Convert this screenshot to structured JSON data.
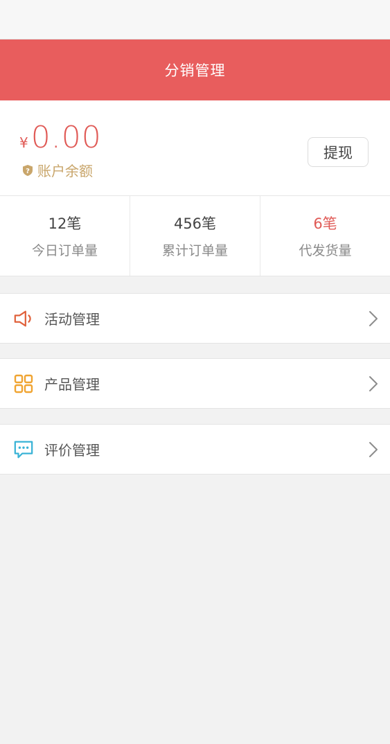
{
  "header": {
    "title": "分销管理"
  },
  "balance": {
    "currency_symbol": "¥",
    "amount": "0.00",
    "label": "账户余额",
    "withdraw_label": "提现"
  },
  "stats": [
    {
      "value": "12笔",
      "label": "今日订单量",
      "color": "#444444"
    },
    {
      "value": "456笔",
      "label": "累计订单量",
      "color": "#444444"
    },
    {
      "value": "6笔",
      "label": "代发货量",
      "color": "#e05a56"
    }
  ],
  "menu": [
    {
      "label": "活动管理",
      "icon": "megaphone-icon",
      "icon_color": "#e0623c"
    },
    {
      "label": "产品管理",
      "icon": "grid-icon",
      "icon_color": "#f0a431"
    },
    {
      "label": "评价管理",
      "icon": "comment-icon",
      "icon_color": "#3ab3d6"
    }
  ],
  "colors": {
    "brand_red": "#e85d5d",
    "amount_red": "#e05a56",
    "label_gold": "#c9a66b"
  }
}
